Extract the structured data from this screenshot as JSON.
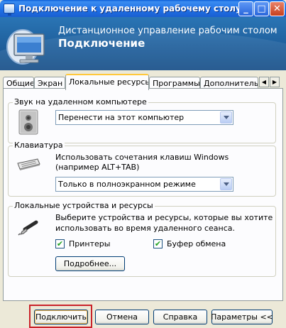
{
  "window": {
    "title": "Подключение к удаленному рабочему столу",
    "controls": {
      "minimize": "_",
      "maximize": "□",
      "close": "✕"
    }
  },
  "banner": {
    "line1": "Дистанционное управление рабочим столом",
    "line2": "Подключение",
    "icon": "remote-desktop-computer-icon"
  },
  "tabs": [
    {
      "label": "Общие",
      "active": false
    },
    {
      "label": "Экран",
      "active": false
    },
    {
      "label": "Локальные ресурсы",
      "active": true
    },
    {
      "label": "Программы",
      "active": false
    },
    {
      "label": "Дополнительно",
      "active": false
    }
  ],
  "tab_scroll": {
    "left": "◀",
    "right": "▶"
  },
  "sound_group": {
    "title": "Звук на удаленном компьютере",
    "selected": "Перенести на этот компьютер",
    "icon": "speaker-icon"
  },
  "keyboard_group": {
    "title": "Клавиатура",
    "description_line1": "Использовать сочетания клавиш Windows",
    "description_line2": "(например ALT+TAB)",
    "selected": "Только в полноэкранном режиме",
    "icon": "keyboard-icon"
  },
  "devices_group": {
    "title": "Локальные устройства и ресурсы",
    "description_line1": "Выберите устройства и ресурсы, которые вы хотите",
    "description_line2": "использовать во время удаленного сеанса.",
    "printers_label": "Принтеры",
    "printers_checked": true,
    "clipboard_label": "Буфер обмена",
    "clipboard_checked": true,
    "more_button": "Подробнее...",
    "icon": "usb-plug-icon",
    "check_mark": "✔"
  },
  "footer": {
    "connect": "Подключить",
    "cancel": "Отмена",
    "help": "Справка",
    "options": "Параметры <<"
  },
  "colors": {
    "titlebar": "#1f6fe6",
    "banner": "#1f5f9c",
    "highlight_border": "#c9232a",
    "active_tab_accent": "#ffc83c"
  }
}
